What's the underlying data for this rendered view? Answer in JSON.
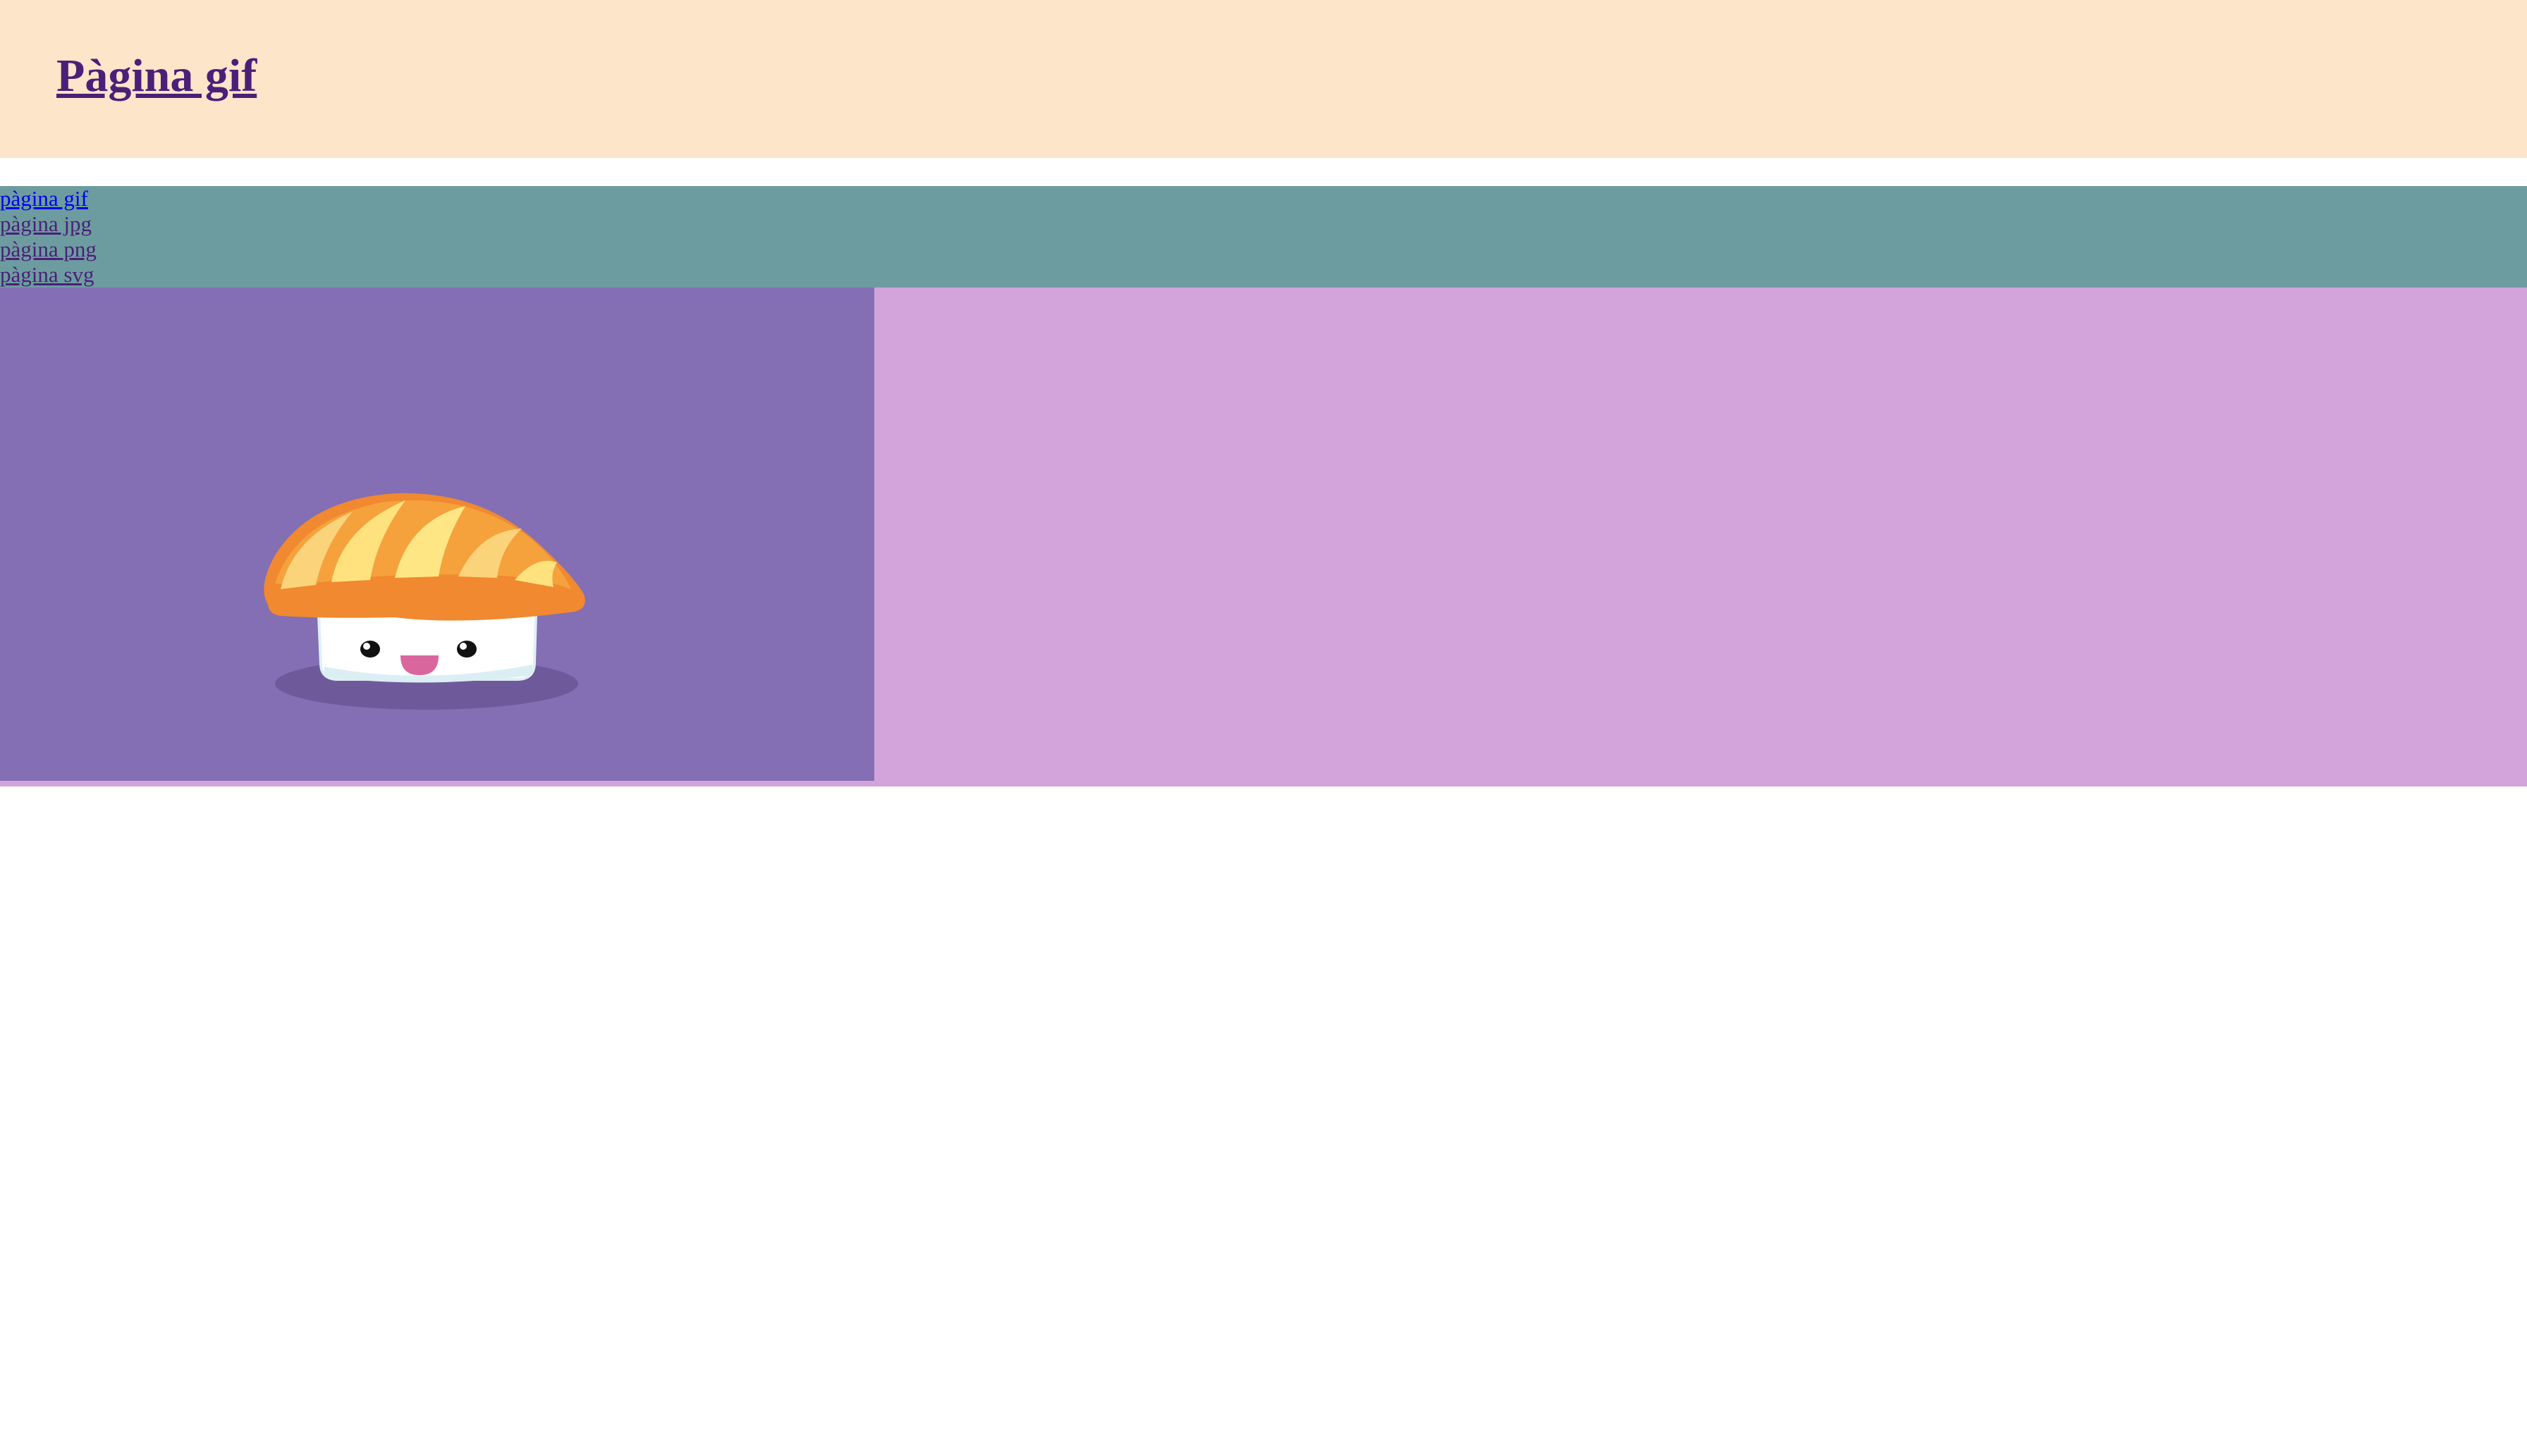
{
  "header": {
    "title": "Pàgina gif"
  },
  "nav": {
    "items": [
      {
        "label": "pàgina gif",
        "active": true
      },
      {
        "label": "pàgina jpg",
        "active": false
      },
      {
        "label": "pàgina png",
        "active": false
      },
      {
        "label": "pàgina svg",
        "active": false
      }
    ]
  },
  "main": {
    "image_icon": "sushi-icon"
  },
  "colors": {
    "header_bg": "#fce5c9",
    "nav_bg": "#6d9ca0",
    "main_bg": "#d3a4db",
    "figure_bg": "#846eb4",
    "title_link": "#4b1f78",
    "active_link": "#0000ee"
  }
}
